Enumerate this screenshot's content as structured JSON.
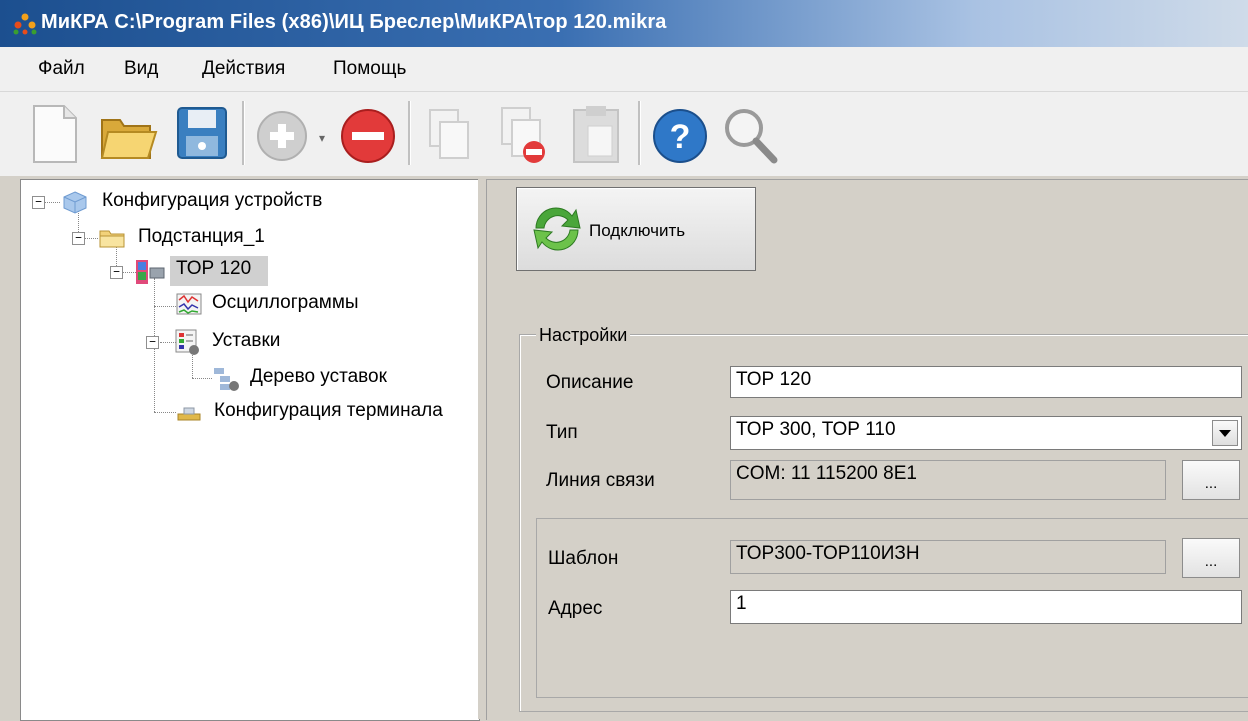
{
  "window": {
    "title": "МиКРА C:\\Program Files (x86)\\ИЦ Бреслер\\МиКРА\\тор 120.mikra"
  },
  "menu": {
    "items": [
      "Файл",
      "Вид",
      "Действия",
      "Помощь"
    ]
  },
  "toolbar": {
    "buttons": [
      "new-document-icon",
      "open-folder-icon",
      "save-disk-icon",
      "add-circle-icon",
      "remove-circle-icon",
      "copy-icon",
      "delete-copy-icon",
      "paste-icon",
      "help-icon",
      "search-icon"
    ]
  },
  "tree": {
    "root": "Конфигурация устройств",
    "substation": "Подстанция_1",
    "device": "ТОР 120",
    "oscillograms": "Осциллограммы",
    "settings": "Уставки",
    "settings_tree": "Дерево уставок",
    "terminal_config": "Конфигурация терминала"
  },
  "connect": {
    "label": "Подключить"
  },
  "settings": {
    "legend": "Настройки",
    "description_label": "Описание",
    "description_value": "ТОР 120",
    "type_label": "Тип",
    "type_value": "ТОР 300, ТОР 110",
    "link_label": "Линия связи",
    "link_value": "COM: 11 115200 8E1",
    "browse_label": "...",
    "template_label": "Шаблон",
    "template_value": "ТОР300-ТОР110ИЗН",
    "address_label": "Адрес",
    "address_value": "1"
  },
  "colors": {
    "titlebar": "#1c4f8f",
    "panel": "#d4d0c8",
    "selection": "#d0d0d0"
  }
}
